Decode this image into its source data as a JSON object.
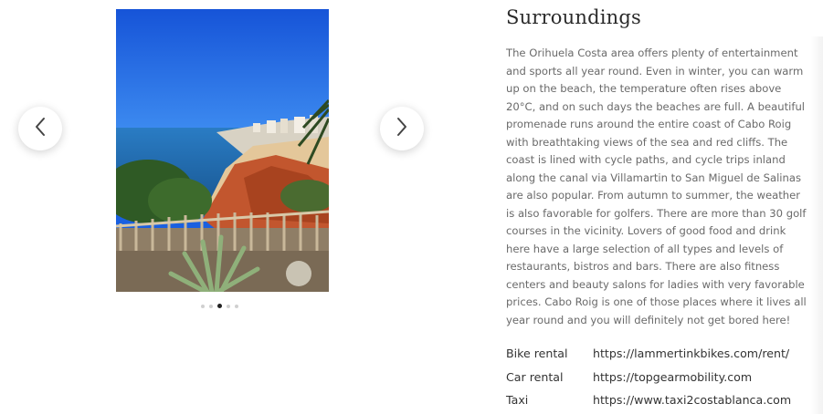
{
  "section": {
    "heading": "Surroundings",
    "paragraph": "The Orihuela Costa area offers plenty of entertainment and sports all year round. Even in winter, you can warm up on the beach, the temperature often rises above 20°C, and on such days the beaches are full. A beautiful promenade runs around the entire coast of Cabo Roig with breathtaking views of the sea and red cliffs. The coast is lined with cycle paths, and cycle trips inland along the canal via Villamartin to San Miguel de Salinas are also popular. From autumn to summer, the weather is also favorable for golfers. There are more than 30 golf courses in the vicinity. Lovers of good food and drink here have a large selection of all types and levels of restaurants, bistros and bars. There are also fitness centers and beauty salons for ladies with very favorable prices. Cabo Roig is one of those places where it lives all year round and you will definitely not get bored here!"
  },
  "rentals": [
    {
      "label": "Bike rental",
      "url": "https://lammertinkbikes.com/rent/"
    },
    {
      "label": "Car rental",
      "url": "https://topgearmobility.com"
    },
    {
      "label": "Taxi",
      "url": "https://www.taxi2costablanca.com"
    }
  ],
  "carousel": {
    "slide_count": 5,
    "active_index": 2,
    "prev_icon": "chevron-left-icon",
    "next_icon": "chevron-right-icon"
  },
  "colors": {
    "sky": "#1b62e6",
    "sea": "#1f6fb8",
    "cliff": "#c2562e",
    "text": "#6a6a6a"
  }
}
